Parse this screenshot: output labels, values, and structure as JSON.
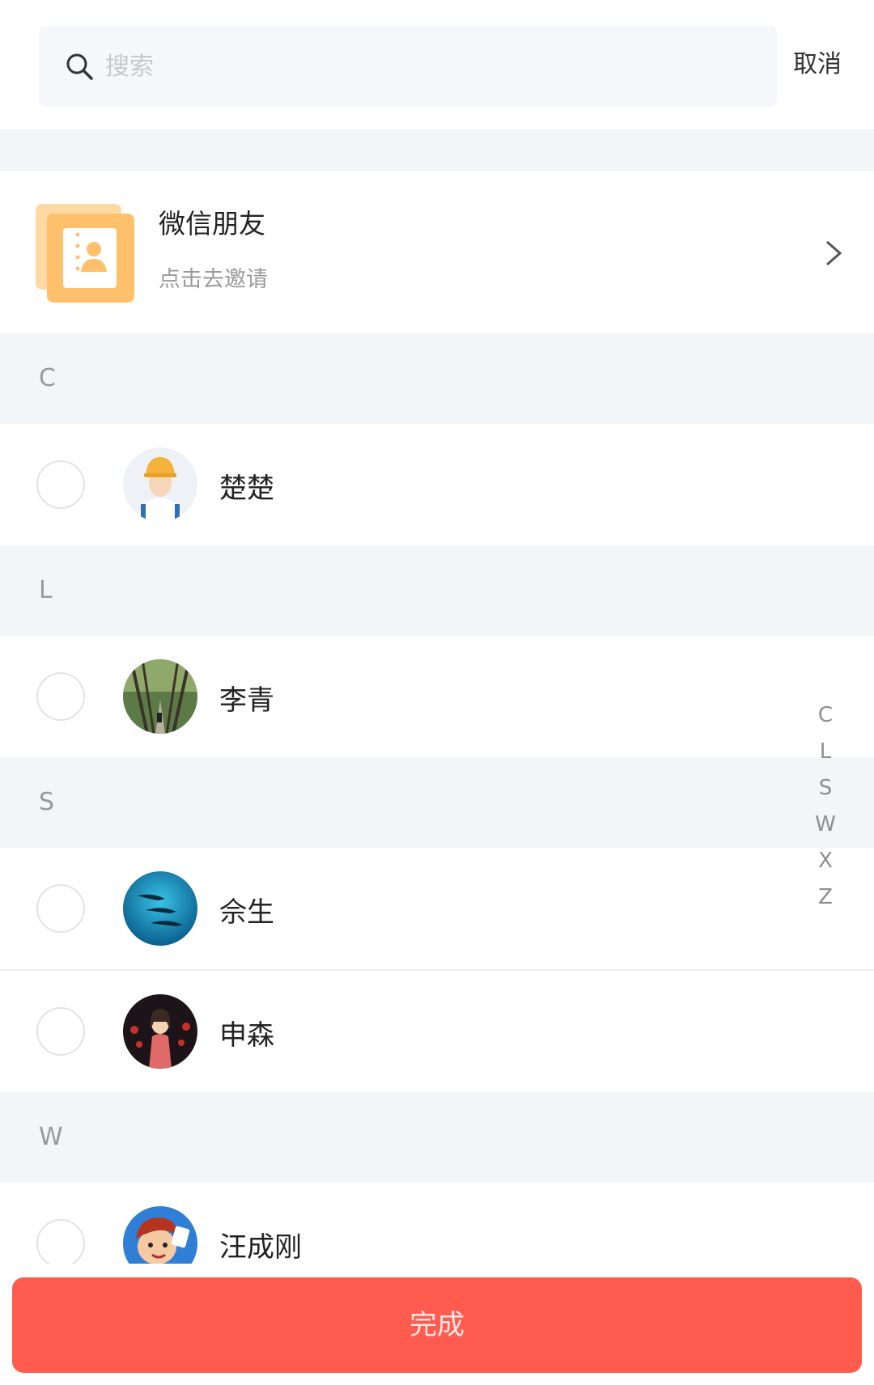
{
  "search": {
    "placeholder": "搜索",
    "cancel_label": "取消"
  },
  "invite": {
    "title": "微信朋友",
    "subtitle": "点击去邀请",
    "icon": "contact-book-icon"
  },
  "sections": [
    {
      "letter": "C",
      "contacts": [
        {
          "name": "楚楚",
          "avatar": "worker-avatar"
        }
      ]
    },
    {
      "letter": "L",
      "contacts": [
        {
          "name": "李青",
          "avatar": "forest-path-avatar"
        }
      ]
    },
    {
      "letter": "S",
      "contacts": [
        {
          "name": "佘生",
          "avatar": "dolphins-avatar"
        },
        {
          "name": "申森",
          "avatar": "anime-girl-avatar"
        }
      ]
    },
    {
      "letter": "W",
      "contacts": [
        {
          "name": "汪成刚",
          "avatar": "cartoon-boy-avatar"
        }
      ]
    }
  ],
  "index_letters": [
    "C",
    "L",
    "S",
    "W",
    "X",
    "Z"
  ],
  "done_label": "完成",
  "colors": {
    "accent": "#ff5b4f",
    "section_bg": "#f4f5f6",
    "invite_icon": "#ffc06b"
  }
}
